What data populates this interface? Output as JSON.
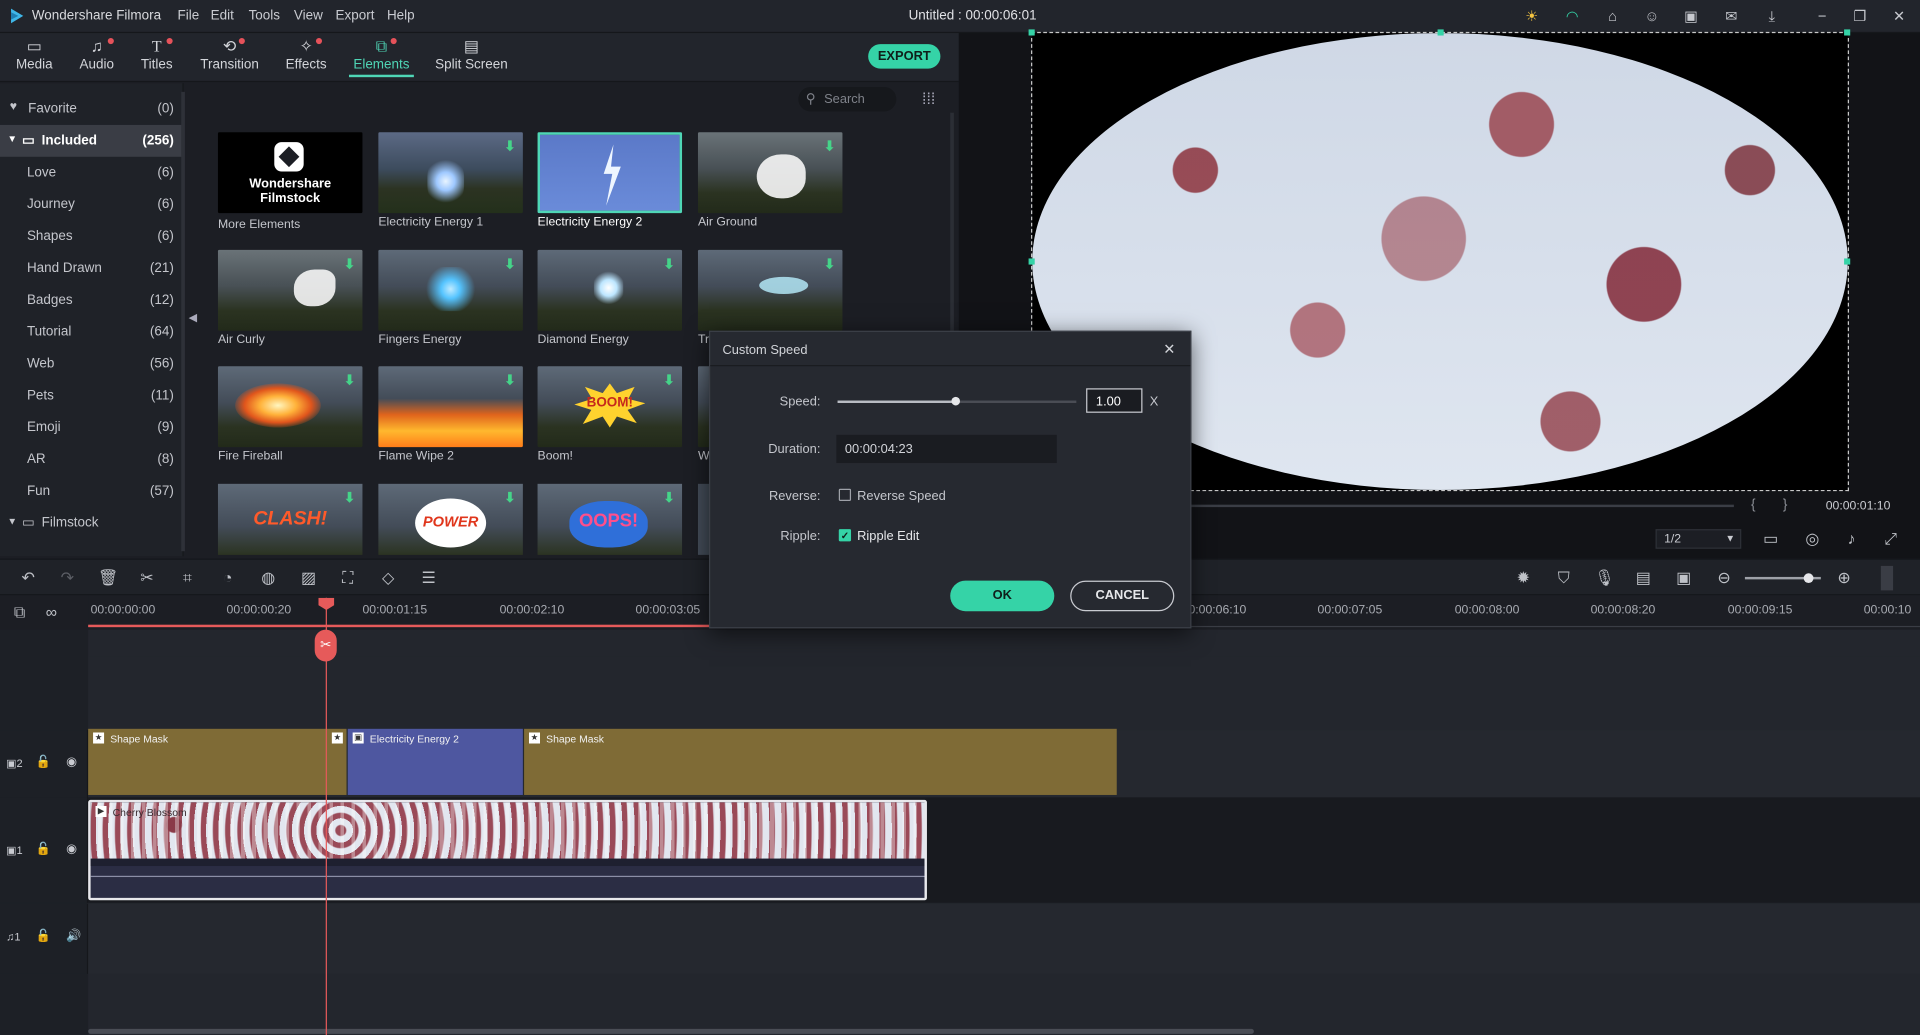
{
  "app": {
    "name": "Wondershare Filmora",
    "doc_title": "Untitled : 00:00:06:01"
  },
  "menu": [
    "File",
    "Edit",
    "Tools",
    "View",
    "Export",
    "Help"
  ],
  "tabs": [
    {
      "label": "Media",
      "icon": "folder-icon",
      "dot": false
    },
    {
      "label": "Audio",
      "icon": "music-note-icon",
      "dot": true
    },
    {
      "label": "Titles",
      "icon": "text-t-icon",
      "dot": true
    },
    {
      "label": "Transition",
      "icon": "transition-icon",
      "dot": true
    },
    {
      "label": "Effects",
      "icon": "effects-icon",
      "dot": true
    },
    {
      "label": "Elements",
      "icon": "elements-icon",
      "dot": true
    },
    {
      "label": "Split Screen",
      "icon": "split-screen-icon",
      "dot": false
    }
  ],
  "export_label": "EXPORT",
  "sidebar": {
    "favorite": {
      "label": "Favorite",
      "count": "(0)"
    },
    "included": {
      "label": "Included",
      "count": "(256)"
    },
    "items": [
      {
        "label": "Love",
        "count": "(6)"
      },
      {
        "label": "Journey",
        "count": "(6)"
      },
      {
        "label": "Shapes",
        "count": "(6)"
      },
      {
        "label": "Hand Drawn",
        "count": "(21)"
      },
      {
        "label": "Badges",
        "count": "(12)"
      },
      {
        "label": "Tutorial",
        "count": "(64)"
      },
      {
        "label": "Web",
        "count": "(56)"
      },
      {
        "label": "Pets",
        "count": "(11)"
      },
      {
        "label": "Emoji",
        "count": "(9)"
      },
      {
        "label": "AR",
        "count": "(8)"
      },
      {
        "label": "Fun",
        "count": "(57)"
      }
    ],
    "filmstock": {
      "label": "Filmstock"
    }
  },
  "search": {
    "placeholder": "Search"
  },
  "elements": [
    {
      "label": "More Elements",
      "kind": "filmstock",
      "brand": "Wondershare Filmstock"
    },
    {
      "label": "Electricity Energy 1"
    },
    {
      "label": "Electricity Energy 2",
      "selected": true
    },
    {
      "label": "Air Ground"
    },
    {
      "label": "Air Curly"
    },
    {
      "label": "Fingers Energy"
    },
    {
      "label": "Diamond Energy"
    },
    {
      "label": "Tr"
    },
    {
      "label": "Fire Fireball"
    },
    {
      "label": "Flame Wipe 2"
    },
    {
      "label": "Boom!",
      "text": "BOOM!"
    },
    {
      "label": "W"
    },
    {
      "label": "",
      "text": "CLASH!"
    },
    {
      "label": "",
      "text": "POWER"
    },
    {
      "label": "",
      "text": "OOPS!"
    }
  ],
  "player": {
    "timecode": "00:00:01:10",
    "quality": "1/2"
  },
  "ruler": [
    "00:00:00:00",
    "00:00:00:20",
    "00:00:01:15",
    "00:00:02:10",
    "00:00:03:05",
    "00:00:06:10",
    "00:00:07:05",
    "00:00:08:00",
    "00:00:08:20",
    "00:00:09:15",
    "00:00:10"
  ],
  "tracks": {
    "track2": {
      "label": "2",
      "clips": [
        "Shape Mask",
        "Electricity Energy 2",
        "Shape Mask"
      ]
    },
    "track1": {
      "label": "1",
      "clip": "Cherry Blossom"
    },
    "audio1": {
      "label": "1"
    }
  },
  "dialog": {
    "title": "Custom Speed",
    "speed_label": "Speed:",
    "speed_value": "1.00",
    "speed_unit": "X",
    "speed_slider_fraction": 0.49,
    "duration_label": "Duration:",
    "duration_value": "00:00:04:23",
    "reverse_label": "Reverse:",
    "reverse_option": "Reverse Speed",
    "reverse_checked": false,
    "ripple_label": "Ripple:",
    "ripple_option": "Ripple Edit",
    "ripple_checked": true,
    "ok": "OK",
    "cancel": "CANCEL"
  },
  "colors": {
    "accent": "#35d3a7",
    "track_gold": "#7f6b36",
    "track_blue": "#4e57a0",
    "playhead": "#e65a5a"
  }
}
